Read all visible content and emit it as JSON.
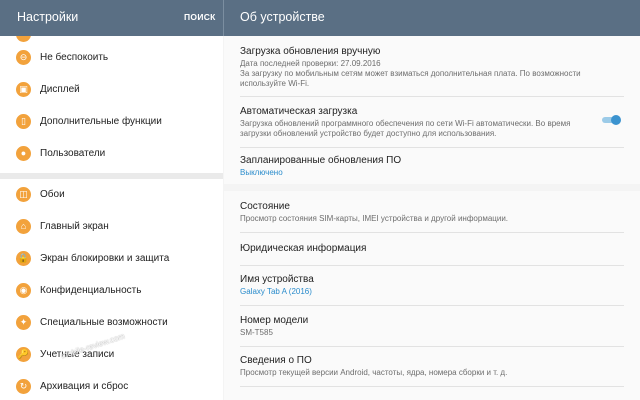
{
  "appbar": {
    "title": "Настройки",
    "search": "ПОИСК",
    "detail_title": "Об устройстве"
  },
  "sidebar": {
    "items": [
      {
        "label": "Не беспокоить",
        "icon": "do-not-disturb-icon",
        "glyph": "⊖"
      },
      {
        "label": "Дисплей",
        "icon": "display-icon",
        "glyph": "▣"
      },
      {
        "label": "Дополнительные функции",
        "icon": "advanced-features-icon",
        "glyph": "▯"
      },
      {
        "label": "Пользователи",
        "icon": "users-icon",
        "glyph": "●"
      },
      {
        "label": "Обои",
        "icon": "wallpaper-icon",
        "glyph": "◫"
      },
      {
        "label": "Главный экран",
        "icon": "home-screen-icon",
        "glyph": "⌂"
      },
      {
        "label": "Экран блокировки и защита",
        "icon": "lock-screen-icon",
        "glyph": "🔒"
      },
      {
        "label": "Конфиденциальность",
        "icon": "privacy-icon",
        "glyph": "◉"
      },
      {
        "label": "Специальные возможности",
        "icon": "accessibility-icon",
        "glyph": "✦"
      },
      {
        "label": "Учетные записи",
        "icon": "accounts-icon",
        "glyph": "🔑"
      },
      {
        "label": "Архивация и сброс",
        "icon": "backup-reset-icon",
        "glyph": "↻"
      }
    ]
  },
  "detail": {
    "manual_update": {
      "title": "Загрузка обновления вручную",
      "line1": "Дата последней проверки: 27.09.2016",
      "line2": "За загрузку по мобильным сетям может взиматься дополнительная плата. По возможности используйте Wi-Fi."
    },
    "auto_download": {
      "title": "Автоматическая загрузка",
      "desc": "Загрузка обновлений программного обеспечения по сети Wi-Fi автоматически. Во время загрузки обновлений устройство будет доступно для использования.",
      "enabled": true
    },
    "scheduled": {
      "title": "Запланированные обновления ПО",
      "value": "Выключено"
    },
    "status": {
      "title": "Состояние",
      "desc": "Просмотр состояния SIM-карты, IMEI устройства и другой информации."
    },
    "legal": {
      "title": "Юридическая информация"
    },
    "device_name": {
      "title": "Имя устройства",
      "value": "Galaxy Tab A (2016)"
    },
    "model": {
      "title": "Номер модели",
      "value": "SM-T585"
    },
    "software": {
      "title": "Сведения о ПО",
      "desc": "Просмотр текущей версии Android, частоты, ядра, номера сборки и т. д."
    }
  },
  "watermark": "mobile-review.com",
  "colors": {
    "appbar": "#5a6f84",
    "icon_accent": "#f2a23c",
    "link_accent": "#2a8ccc",
    "toggle_on": "#3b93cf"
  }
}
